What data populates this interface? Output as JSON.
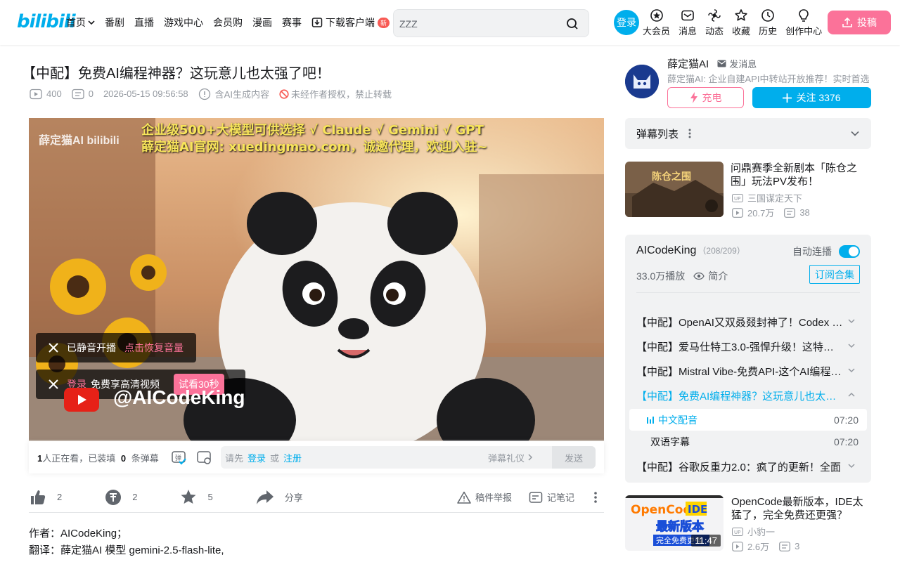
{
  "header": {
    "logo": "bilibili",
    "nav": [
      {
        "label": "首页",
        "has_dropdown": true
      },
      {
        "label": "番剧"
      },
      {
        "label": "直播"
      },
      {
        "label": "游戏中心"
      },
      {
        "label": "会员购"
      },
      {
        "label": "漫画"
      },
      {
        "label": "赛事"
      },
      {
        "label": "下载客户端",
        "badge": "新"
      }
    ],
    "search_placeholder": "ZZZ",
    "login_label": "登录",
    "entries": [
      {
        "label": "大会员",
        "icon": "vip-icon"
      },
      {
        "label": "消息",
        "icon": "message-icon"
      },
      {
        "label": "动态",
        "icon": "dynamic-icon"
      },
      {
        "label": "收藏",
        "icon": "favorite-icon"
      },
      {
        "label": "历史",
        "icon": "history-icon"
      },
      {
        "label": "创作中心",
        "icon": "creator-icon"
      }
    ],
    "upload_label": "投稿"
  },
  "video": {
    "title": "【中配】免费AI编程神器？这玩意儿也太强了吧！",
    "views": "400",
    "danmaku_count": "0",
    "date": "2026-05-15 09:56:58",
    "ai_notice": "含AI生成内容",
    "copyright": "未经作者授权，禁止转载",
    "banner_line1": "企业级500+大模型可供选择 √ Claude √ Gemini √ GPT",
    "banner_line2": "薛定猫AI官网: xuedingmao.com，诚邀代理，欢迎入驻~",
    "watermark": "薛定猫AI  bilibili",
    "overlay_handle": "@AICodeKing",
    "toast_muted": "已静音开播",
    "toast_unmute": "点击恢复音量",
    "toast_login": "登录",
    "toast_hd": "免费享高清视频",
    "toast_try": "试看30秒"
  },
  "danmaku_bar": {
    "watching_count": "1",
    "watching_text": "人正在看，已装填",
    "loaded_count": "0",
    "loaded_text": "条弹幕",
    "prompt_prefix": "请先",
    "login": "登录",
    "or": "或",
    "register": "注册",
    "etiquette": "弹幕礼仪",
    "send": "发送"
  },
  "toolbar": {
    "like_count": "2",
    "coin_count": "2",
    "fav_count": "5",
    "share_label": "分享",
    "report_label": "稿件举报",
    "note_label": "记笔记"
  },
  "description": {
    "line1": "作者：AICodeKing；",
    "line2": "翻译：薛定猫AI 模型 gemini-2.5-flash-lite,"
  },
  "uploader": {
    "name": "薛定猫AI",
    "message_label": "发消息",
    "desc": "薛定猫AI: 企业自建API中转站开放推荐！实时首选",
    "charge_label": "充电",
    "follow_label": "关注 3376"
  },
  "danmaku_list": {
    "label": "弹幕列表"
  },
  "ad_card": {
    "title": "问鼎赛季全新剧本「陈仓之围」玩法PV发布！",
    "up": "三国谋定天下",
    "views": "20.7万",
    "danmaku": "38"
  },
  "collection": {
    "title": "AICodeKing",
    "count": "（208/209）",
    "autoplay_label": "自动连播",
    "autoplay_on": true,
    "plays": "33.0万播放",
    "intro_label": "简介",
    "subscribe_label": "订阅合集",
    "items": [
      {
        "title": "【中配】OpenAI又双叒叕封神了！Codex 新功能"
      },
      {
        "title": "【中配】爱马仕特工3.0-强悍升级！这特工真的强"
      },
      {
        "title": "【中配】Mistral Vibe-免费API-这个AI编程工具"
      },
      {
        "title": "【中配】免费AI编程神器？这玩意儿也太强了吧！"
      },
      {
        "title": "【中配】谷歌反重力2.0：疯了的更新！全面"
      }
    ],
    "parts": [
      {
        "title": "中文配音",
        "duration": "07:20"
      },
      {
        "title": "双语字幕",
        "duration": "07:20"
      }
    ]
  },
  "rec_card": {
    "title": "OpenCode最新版本，IDE太猛了，完全免费还更强？",
    "up": "小豹一",
    "views": "2.6万",
    "danmaku": "3",
    "duration": "11:47",
    "thumb_text1": "OpenCode",
    "thumb_text2": "IDE",
    "thumb_text3": "最新版本",
    "thumb_text4": "完全免费更强"
  }
}
